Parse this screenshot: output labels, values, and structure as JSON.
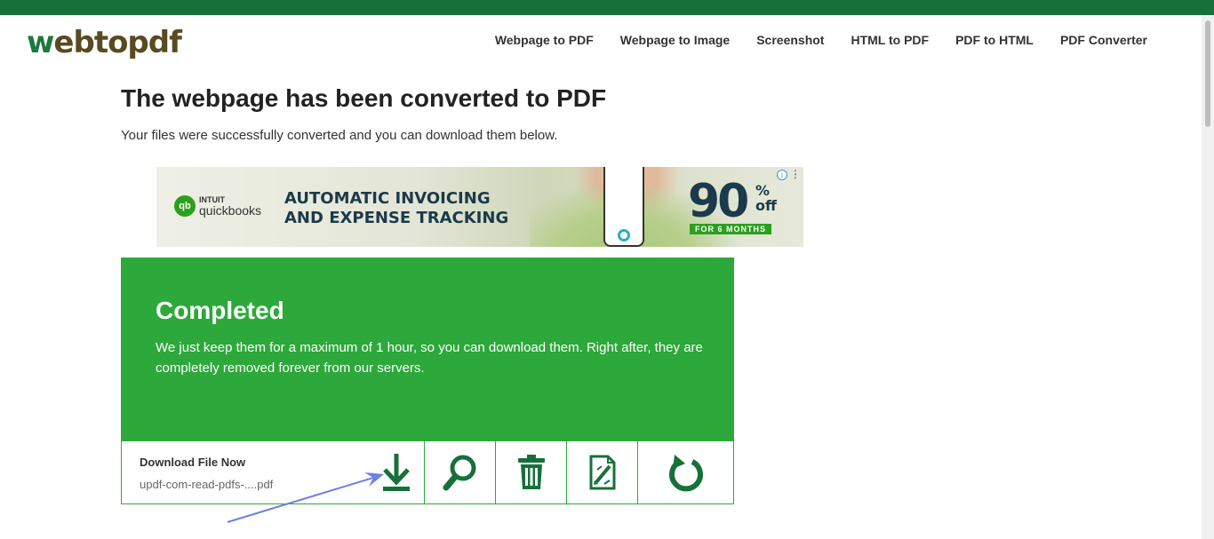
{
  "brand": {
    "logo_w": "w",
    "logo_rest": "ebtopdf"
  },
  "nav": [
    {
      "label": "Webpage to PDF"
    },
    {
      "label": "Webpage to Image"
    },
    {
      "label": "Screenshot"
    },
    {
      "label": "HTML to PDF"
    },
    {
      "label": "PDF to HTML"
    },
    {
      "label": "PDF Converter"
    }
  ],
  "page": {
    "title": "The webpage has been converted to PDF",
    "subtitle": "Your files were successfully converted and you can download them below."
  },
  "ad": {
    "brand_top": "INTUIT",
    "brand_name": "quickbooks",
    "headline_1": "AUTOMATIC INVOICING",
    "headline_2": "AND EXPENSE TRACKING",
    "percent": "90",
    "pct_sign": "%",
    "off": "off",
    "months": "FOR 6 MONTHS"
  },
  "completed": {
    "title": "Completed",
    "message": "We just keep them for a maximum of 1 hour, so you can download them. Right after, they are completely removed forever from our servers."
  },
  "file": {
    "label": "Download File Now",
    "name": "updf-com-read-pdfs-....pdf"
  },
  "actions": [
    "download-icon",
    "search-icon",
    "trash-icon",
    "edit-pdf-icon",
    "restart-icon"
  ],
  "colors": {
    "brand_dark": "#17703a",
    "brand_green": "#2da83b",
    "icon_green": "#17703a",
    "annotation_arrow": "#6f7fe6"
  }
}
